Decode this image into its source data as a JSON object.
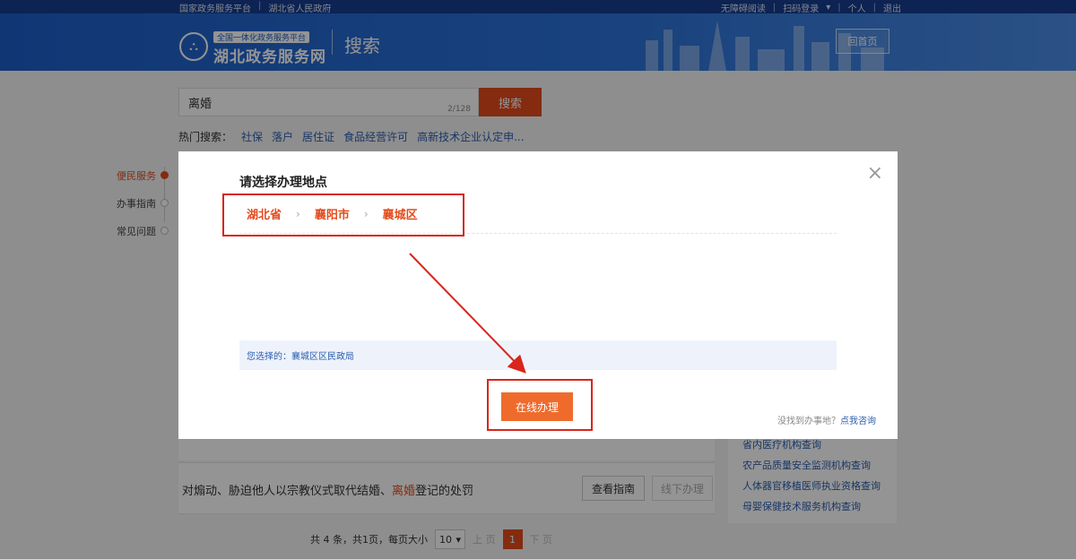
{
  "topbar": {
    "left_links": [
      "国家政务服务平台",
      "湖北省人民政府"
    ],
    "right_links": [
      "无障碍阅读",
      "扫码登录",
      "个人",
      "退出"
    ]
  },
  "header": {
    "logo_sub": "全国一体化政务服务平台",
    "logo_main": "湖北政务服务网",
    "page_title": "搜索",
    "home_button": "回首页"
  },
  "search": {
    "value": "离婚",
    "count": "2/128",
    "button": "搜索",
    "hot_label": "热门搜索：",
    "hot_items": [
      "社保",
      "落户",
      "居住证",
      "食品经营许可",
      "高新技术企业认定申..."
    ]
  },
  "sidenav": {
    "items": [
      "便民服务",
      "办事指南",
      "常见问题"
    ]
  },
  "results": {
    "row_title_before": "对煽动、胁迫他人以宗教仪式取代结婚、",
    "row_title_highlight": "离婚",
    "row_title_after": "登记的处罚",
    "guide_button": "查看指南",
    "offline_button": "线下办理"
  },
  "right_panel": {
    "links": [
      "省内医疗机构查询",
      "农产品质量安全监测机构查询",
      "人体器官移植医师执业资格查询",
      "母婴保健技术服务机构查询"
    ]
  },
  "pagination": {
    "summary": "共 4 条，共1页，每页大小",
    "page_size": "10",
    "prev": "上 页",
    "current": "1",
    "next": "下 页"
  },
  "modal": {
    "title": "请选择办理地点",
    "close": "×",
    "crumbs": [
      "湖北省",
      "襄阳市",
      "襄城区"
    ],
    "crumb_sep": "›",
    "selected_label": "您选择的：",
    "selected_value": "襄城区区民政局",
    "online_button": "在线办理",
    "consult_text": "没找到办事地？",
    "consult_link": "点我咨询"
  },
  "colors": {
    "accent": "#e34b1c",
    "header_blue": "#1d5fc9",
    "link_blue": "#2b5db0",
    "annotation_red": "#d9251c"
  }
}
